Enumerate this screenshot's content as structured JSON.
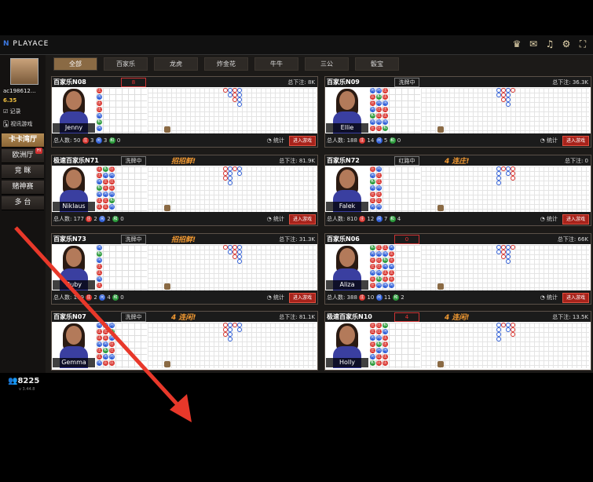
{
  "app": {
    "logo": "PLAYACE",
    "icons": [
      "crown-icon",
      "chat-icon",
      "music-icon",
      "gear-icon",
      "fullscreen-icon"
    ]
  },
  "user": {
    "name": "ac198612...",
    "balance": "6.35",
    "record": "记录",
    "video_game": "视讯游戏"
  },
  "sidebar": {
    "items": [
      {
        "label": "卡卡湾厅",
        "active": true
      },
      {
        "label": "欧洲厅",
        "badge": "Hi"
      },
      {
        "label": "竞 眯"
      },
      {
        "label": "赌神赛"
      },
      {
        "label": "多 台"
      }
    ],
    "online": "8225",
    "version": "v 3.44.8"
  },
  "tabs": [
    "全部",
    "百家乐",
    "龙虎",
    "炸金花",
    "牛牛",
    "三公",
    "骰宝"
  ],
  "tables": [
    {
      "name": "百家乐N08",
      "shoe": "8",
      "shoe_style": "red",
      "promo": "",
      "bet": "总下注: 8K",
      "dealer": "Jenny",
      "players": "总人数: 50",
      "z": "3",
      "x": "3",
      "h": "0",
      "tj": "统计",
      "enter": "进入游戏"
    },
    {
      "name": "百家乐N09",
      "shoe": "洗牌中",
      "shoe_style": "",
      "promo": "",
      "bet": "总下注: 36.3K",
      "dealer": "Ellie",
      "players": "总人数: 188",
      "z": "14",
      "x": "5",
      "h": "0",
      "tj": "统计",
      "enter": "进入游戏"
    },
    {
      "name": "极速百家乐N71",
      "shoe": "洗牌中",
      "shoe_style": "",
      "promo": "招招鲜!",
      "bet": "总下注: 81.9K",
      "dealer": "Niklaus",
      "players": "总人数: 177",
      "z": "2",
      "x": "2",
      "h": "0",
      "tj": "统计",
      "enter": "进入游戏"
    },
    {
      "name": "百家乐N72",
      "shoe": "红路中",
      "shoe_style": "",
      "promo": "4 连庄!",
      "bet": "总下注: 0",
      "dealer": "Falek",
      "players": "总人数: 810",
      "z": "12",
      "x": "7",
      "h": "4",
      "tj": "统计",
      "enter": "进入游戏"
    },
    {
      "name": "百家乐N73",
      "shoe": "洗牌中",
      "shoe_style": "",
      "promo": "招招鲜!",
      "bet": "总下注: 31.3K",
      "dealer": "Ruby",
      "players": "总人数: 109",
      "z": "2",
      "x": "4",
      "h": "0",
      "tj": "统计",
      "enter": "进入游戏"
    },
    {
      "name": "百家乐N06",
      "shoe": "0",
      "shoe_style": "red",
      "promo": "",
      "bet": "总下注: 66K",
      "dealer": "Aliza",
      "players": "总人数: 388",
      "z": "10",
      "x": "11",
      "h": "2",
      "tj": "统计",
      "enter": "进入游戏"
    },
    {
      "name": "百家乐N07",
      "shoe": "洗牌中",
      "shoe_style": "",
      "promo": "4 连闲!",
      "bet": "总下注: 81.1K",
      "dealer": "Gemma",
      "players": "",
      "z": "",
      "x": "",
      "h": "",
      "tj": "",
      "enter": ""
    },
    {
      "name": "极速百家乐N10",
      "shoe": "4",
      "shoe_style": "red",
      "promo": "4 连闲!",
      "bet": "总下注: 13.5K",
      "dealer": "Holly",
      "players": "",
      "z": "",
      "x": "",
      "h": "",
      "tj": "",
      "enter": ""
    }
  ],
  "colors": {
    "banker": "#d8302a",
    "player": "#2f5fd8",
    "tie": "#2a9a3a",
    "accent": "#8a6a44",
    "arrow": "#e8382a"
  }
}
